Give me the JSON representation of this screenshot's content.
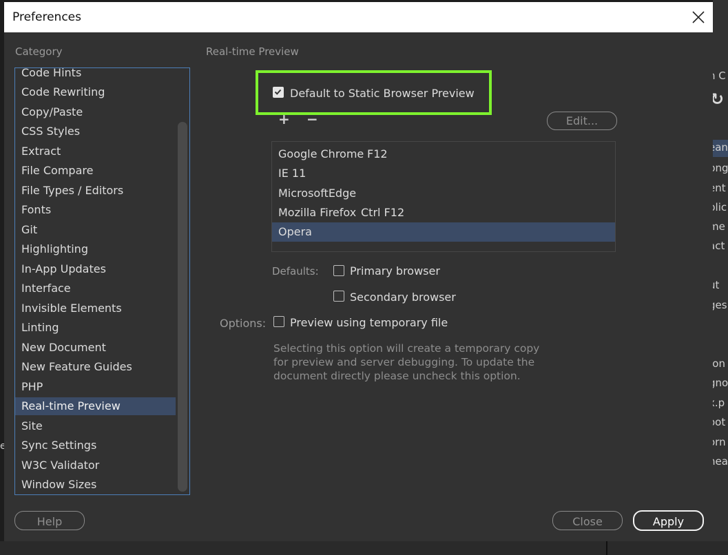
{
  "dialog": {
    "title": "Preferences",
    "close_icon": "close-icon"
  },
  "category": {
    "label": "Category",
    "items": [
      "Code Hints",
      "Code Rewriting",
      "Copy/Paste",
      "CSS Styles",
      "Extract",
      "File Compare",
      "File Types / Editors",
      "Fonts",
      "Git",
      "Highlighting",
      "In-App Updates",
      "Interface",
      "Invisible Elements",
      "Linting",
      "New Document",
      "New Feature Guides",
      "PHP",
      "Real-time Preview",
      "Site",
      "Sync Settings",
      "W3C Validator",
      "Window Sizes"
    ],
    "selected": "Real-time Preview"
  },
  "panel": {
    "title": "Real-time Preview",
    "static_preview": {
      "label": "Default to Static Browser Preview",
      "checked": true
    },
    "add_icon": "plus-icon",
    "remove_icon": "minus-icon",
    "edit_label": "Edit...",
    "browsers": [
      {
        "name": "Google Chrome",
        "key": "F12"
      },
      {
        "name": "IE 11",
        "key": ""
      },
      {
        "name": "MicrosoftEdge",
        "key": ""
      },
      {
        "name": "Mozilla Firefox",
        "key": "Ctrl F12"
      },
      {
        "name": "Opera",
        "key": ""
      }
    ],
    "selected_browser": "Opera",
    "defaults_label": "Defaults:",
    "primary_browser": {
      "label": "Primary browser",
      "checked": false
    },
    "secondary_browser": {
      "label": "Secondary browser",
      "checked": false
    },
    "options_label": "Options:",
    "temp_file": {
      "label": "Preview using temporary file",
      "checked": false
    },
    "note_lines": [
      "Selecting this option will create a temporary copy",
      "for preview and server debugging. To update the",
      "document directly please uncheck this option."
    ]
  },
  "footer": {
    "help_label": "Help",
    "close_label": "Close",
    "apply_label": "Apply"
  },
  "background_app": {
    "fragments": [
      "n C",
      "ean",
      "png",
      "ent",
      "plic",
      "me",
      "act",
      "ut",
      "ges",
      "fon",
      "gno",
      "x.p",
      "oot",
      "orn",
      "hea"
    ],
    "left_fragment": "e",
    "refresh_icon": "refresh-icon"
  },
  "colors": {
    "dialog_bg": "#323232",
    "selection": "#3b4b66",
    "highlight": "#7ef12e",
    "list_border": "#4d7fb8"
  }
}
